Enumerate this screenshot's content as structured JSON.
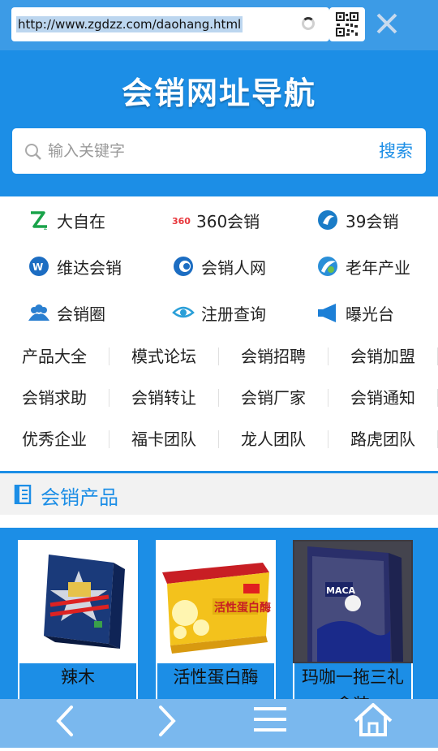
{
  "browser": {
    "url": "http://www.zgdzz.com/daohang.html"
  },
  "header": {
    "title": "会销网址导航",
    "search_placeholder": "输入关键字",
    "search_button": "搜索"
  },
  "featured": [
    {
      "label": "大自在",
      "icon": "dazizai-logo-icon"
    },
    {
      "label": "360会销",
      "icon": "360-logo-icon"
    },
    {
      "label": "39会销",
      "icon": "39-logo-icon"
    },
    {
      "label": "维达会销",
      "icon": "weida-logo-icon"
    },
    {
      "label": "会销人网",
      "icon": "huixiaoren-logo-icon"
    },
    {
      "label": "老年产业",
      "icon": "laonian-logo-icon"
    },
    {
      "label": "会销圈",
      "icon": "people-icon"
    },
    {
      "label": "注册查询",
      "icon": "eye-icon"
    },
    {
      "label": "曝光台",
      "icon": "megaphone-icon"
    }
  ],
  "links": [
    "产品大全",
    "模式论坛",
    "会销招聘",
    "会销加盟",
    "会销求助",
    "会销转让",
    "会销厂家",
    "会销通知",
    "优秀企业",
    "福卡团队",
    "龙人团队",
    "路虎团队"
  ],
  "products_section": {
    "title": "会销产品",
    "items": [
      {
        "name": "辣木"
      },
      {
        "name": "活性蛋白酶"
      },
      {
        "name": "玛咖一拖三礼盒装"
      }
    ]
  },
  "bottom_nav": {
    "items": [
      "back-icon",
      "forward-icon",
      "menu-icon",
      "home-icon"
    ]
  },
  "colors": {
    "accent": "#1c8ee6",
    "url_bar": "#3c9be6",
    "bottom_bar": "#7ab8ee"
  }
}
